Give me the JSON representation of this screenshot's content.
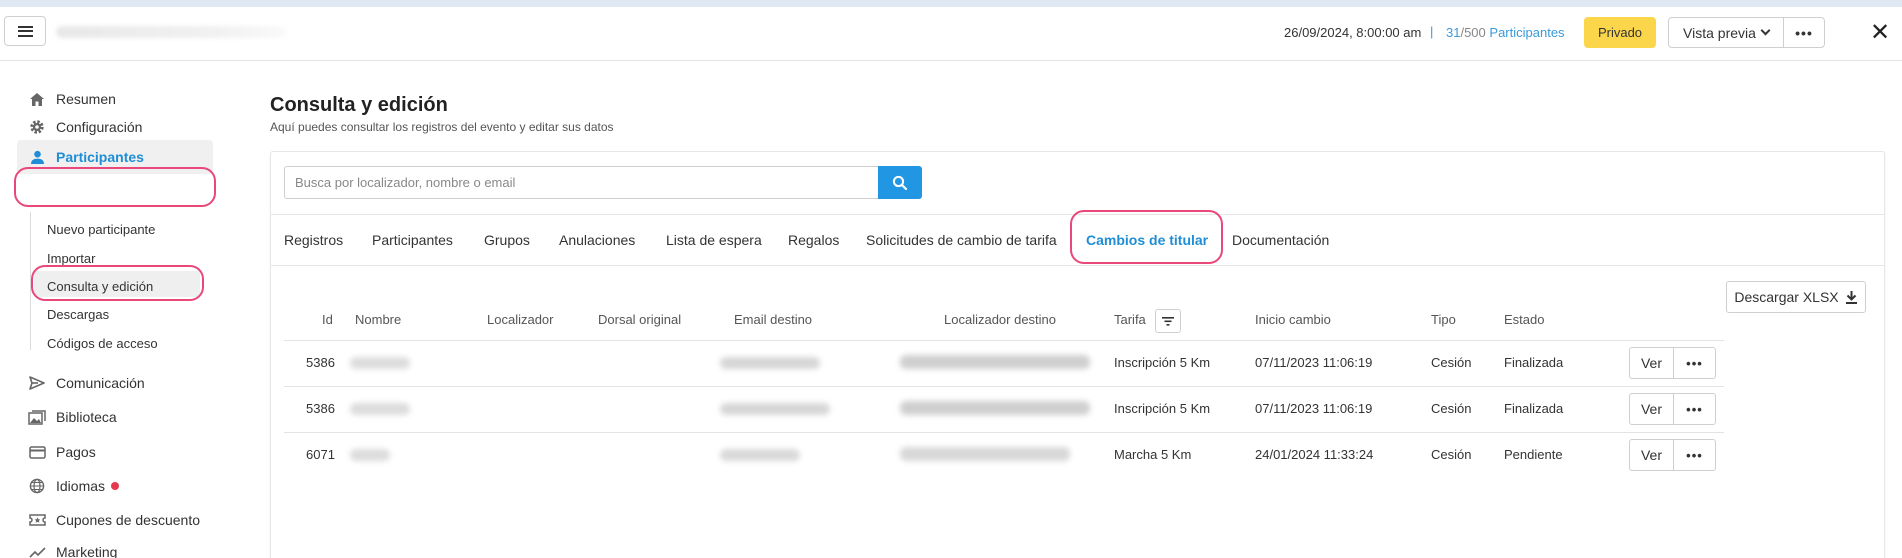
{
  "header": {
    "event_date": "26/09/2024, 8:00:00 am",
    "separator": "|",
    "participants_count": "31",
    "participants_total": "/500",
    "participants_label": "Participantes",
    "private_label": "Privado",
    "preview_label": "Vista previa",
    "more_label": "•••",
    "close_label": "✕"
  },
  "sidebar": {
    "items": [
      {
        "label": "Resumen",
        "icon": "home-icon"
      },
      {
        "label": "Configuración",
        "icon": "gear-icon"
      },
      {
        "label": "Participantes",
        "icon": "user-icon"
      },
      {
        "label": "Comunicación",
        "icon": "send-icon"
      },
      {
        "label": "Biblioteca",
        "icon": "images-icon"
      },
      {
        "label": "Pagos",
        "icon": "card-icon"
      },
      {
        "label": "Idiomas",
        "icon": "globe-icon"
      },
      {
        "label": "Cupones de descuento",
        "icon": "ticket-icon"
      },
      {
        "label": "Marketing",
        "icon": "trend-icon"
      }
    ],
    "sub_items": [
      {
        "label": "Nuevo participante"
      },
      {
        "label": "Importar"
      },
      {
        "label": "Consulta y edición"
      },
      {
        "label": "Descargas"
      },
      {
        "label": "Códigos de acceso"
      }
    ]
  },
  "main": {
    "title": "Consulta y edición",
    "subtitle": "Aquí puedes consultar los registros del evento y editar sus datos",
    "search": {
      "placeholder": "Busca por localizador, nombre o email"
    },
    "tabs": [
      {
        "label": "Registros"
      },
      {
        "label": "Participantes"
      },
      {
        "label": "Grupos"
      },
      {
        "label": "Anulaciones"
      },
      {
        "label": "Lista de espera"
      },
      {
        "label": "Regalos"
      },
      {
        "label": "Solicitudes de cambio de tarifa"
      },
      {
        "label": "Cambios de titular"
      },
      {
        "label": "Documentación"
      }
    ],
    "active_tab": "Cambios de titular",
    "download_label": "Descargar XLSX",
    "table": {
      "columns": [
        "Id",
        "Nombre",
        "Localizador",
        "Dorsal original",
        "Email destino",
        "Localizador destino",
        "Tarifa",
        "Inicio cambio",
        "Tipo",
        "Estado"
      ],
      "rows": [
        {
          "id": "5386",
          "tarifa": "Inscripción 5 Km",
          "inicio": "07/11/2023 11:06:19",
          "tipo": "Cesión",
          "estado": "Finalizada"
        },
        {
          "id": "5386",
          "tarifa": "Inscripción 5 Km",
          "inicio": "07/11/2023 11:06:19",
          "tipo": "Cesión",
          "estado": "Finalizada"
        },
        {
          "id": "6071",
          "tarifa": "Marcha 5 Km",
          "inicio": "24/01/2024 11:33:24",
          "tipo": "Cesión",
          "estado": "Pendiente"
        }
      ],
      "view_label": "Ver",
      "more_label": "•••"
    }
  },
  "colors": {
    "accent": "#1f8ed6",
    "private_btn": "#fbd64b",
    "search_btn": "#2196e3",
    "highlight_ring": "#e8487a"
  }
}
